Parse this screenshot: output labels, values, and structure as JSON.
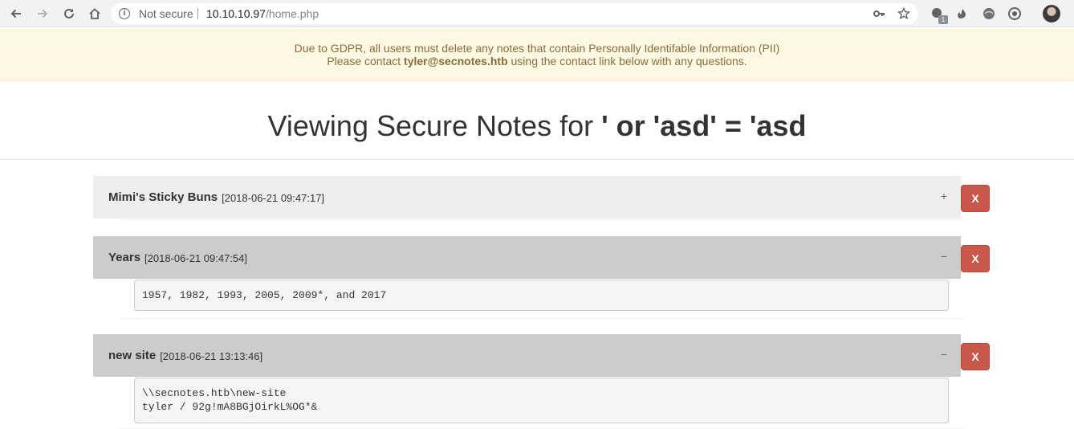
{
  "browser": {
    "security_label": "Not secure",
    "url_host": "10.10.10.97",
    "url_path": "/home.php",
    "extension_badge": "1"
  },
  "banner": {
    "line1": "Due to GDPR, all users must delete any notes that contain Personally Identifable Information (PII)",
    "line2_prefix": "Please contact ",
    "email": "tyler@secnotes.htb",
    "line2_suffix": " using the contact link below with any questions."
  },
  "heading": {
    "prefix": "Viewing Secure Notes for ",
    "username": "' or 'asd' = 'asd"
  },
  "notes": [
    {
      "title": "Mimi's Sticky Buns",
      "date": "[2018-06-21 09:47:17]",
      "toggle": "+",
      "delete_label": "X",
      "content": ""
    },
    {
      "title": "Years",
      "date": "[2018-06-21 09:47:54]",
      "toggle": "−",
      "delete_label": "X",
      "content": "1957, 1982, 1993, 2005, 2009*, and 2017"
    },
    {
      "title": "new site",
      "date": "[2018-06-21 13:13:46]",
      "toggle": "−",
      "delete_label": "X",
      "content": "\\\\secnotes.htb\\new-site\ntyler / 92g!mA8BGjOirkL%OG*&"
    }
  ]
}
